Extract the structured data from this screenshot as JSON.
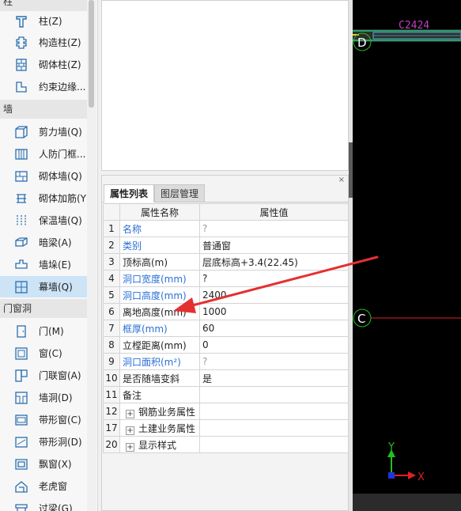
{
  "sidebar": {
    "groups": {
      "column": "柱",
      "wall": "墙",
      "door_window": "门窗洞"
    },
    "items": [
      {
        "label": "柱(Z)",
        "icon": "column-icon"
      },
      {
        "label": "构造柱(Z)",
        "icon": "structural-column-icon"
      },
      {
        "label": "砌体柱(Z)",
        "icon": "masonry-column-icon"
      },
      {
        "label": "约束边缘...",
        "icon": "edge-member-icon"
      },
      {
        "label": "剪力墙(Q)",
        "icon": "shear-wall-icon"
      },
      {
        "label": "人防门框...",
        "icon": "civil-defense-door-icon"
      },
      {
        "label": "砌体墙(Q)",
        "icon": "masonry-wall-icon"
      },
      {
        "label": "砌体加筋(Y",
        "icon": "masonry-rebar-icon"
      },
      {
        "label": "保温墙(Q)",
        "icon": "insulation-wall-icon"
      },
      {
        "label": "暗梁(A)",
        "icon": "hidden-beam-icon"
      },
      {
        "label": "墙垛(E)",
        "icon": "wall-pier-icon"
      },
      {
        "label": "幕墙(Q)",
        "icon": "curtain-wall-icon"
      },
      {
        "label": "门(M)",
        "icon": "door-icon"
      },
      {
        "label": "窗(C)",
        "icon": "window-icon"
      },
      {
        "label": "门联窗(A)",
        "icon": "door-window-icon"
      },
      {
        "label": "墙洞(D)",
        "icon": "wall-opening-icon"
      },
      {
        "label": "带形窗(C)",
        "icon": "strip-window-icon"
      },
      {
        "label": "带形洞(D)",
        "icon": "strip-opening-icon"
      },
      {
        "label": "飘窗(X)",
        "icon": "bay-window-icon"
      },
      {
        "label": "老虎窗",
        "icon": "dormer-window-icon"
      },
      {
        "label": "过梁(G)",
        "icon": "lintel-icon"
      }
    ],
    "selected": "幕墙(Q)"
  },
  "panel": {
    "close": "×",
    "tabs": [
      "属性列表",
      "图层管理"
    ],
    "headers": {
      "name": "属性名称",
      "value": "属性值"
    },
    "rows": [
      {
        "num": "1",
        "name": "名称",
        "value": "?",
        "blue": true,
        "gray": true
      },
      {
        "num": "2",
        "name": "类别",
        "value": "普通窗",
        "blue": true
      },
      {
        "num": "3",
        "name": "顶标高(m)",
        "value": "层底标高+3.4(22.45)"
      },
      {
        "num": "4",
        "name": "洞口宽度(mm)",
        "value": "?",
        "blue": true
      },
      {
        "num": "5",
        "name": "洞口高度(mm)",
        "value": "2400",
        "blue": true
      },
      {
        "num": "6",
        "name": "离地高度(mm)",
        "value": "1000"
      },
      {
        "num": "7",
        "name": "框厚(mm)",
        "value": "60",
        "blue": true
      },
      {
        "num": "8",
        "name": "立樘距离(mm)",
        "value": "0"
      },
      {
        "num": "9",
        "name": "洞口面积(m²)",
        "value": "?",
        "blue": true,
        "gray": true
      },
      {
        "num": "10",
        "name": "是否随墙变斜",
        "value": "是"
      },
      {
        "num": "11",
        "name": "备注",
        "value": ""
      },
      {
        "num": "12",
        "name": "钢筋业务属性",
        "value": "",
        "expand": "+"
      },
      {
        "num": "17",
        "name": "土建业务属性",
        "value": "",
        "expand": "+"
      },
      {
        "num": "20",
        "name": "显示样式",
        "value": "",
        "expand": "+"
      }
    ]
  },
  "cad": {
    "label_top": "C2424",
    "axis_d": "D",
    "axis_c": "C",
    "axis_y": "Y",
    "axis_x": "X",
    "colors": {
      "background": "#000000",
      "axis_line": "#e02020",
      "window_label": "#c040c0",
      "wall": "#30c0a0",
      "axis_circle": "#20c020"
    }
  },
  "annotation": {
    "arrow_color": "#e53030",
    "arrow_target": "离地高度(mm)"
  }
}
